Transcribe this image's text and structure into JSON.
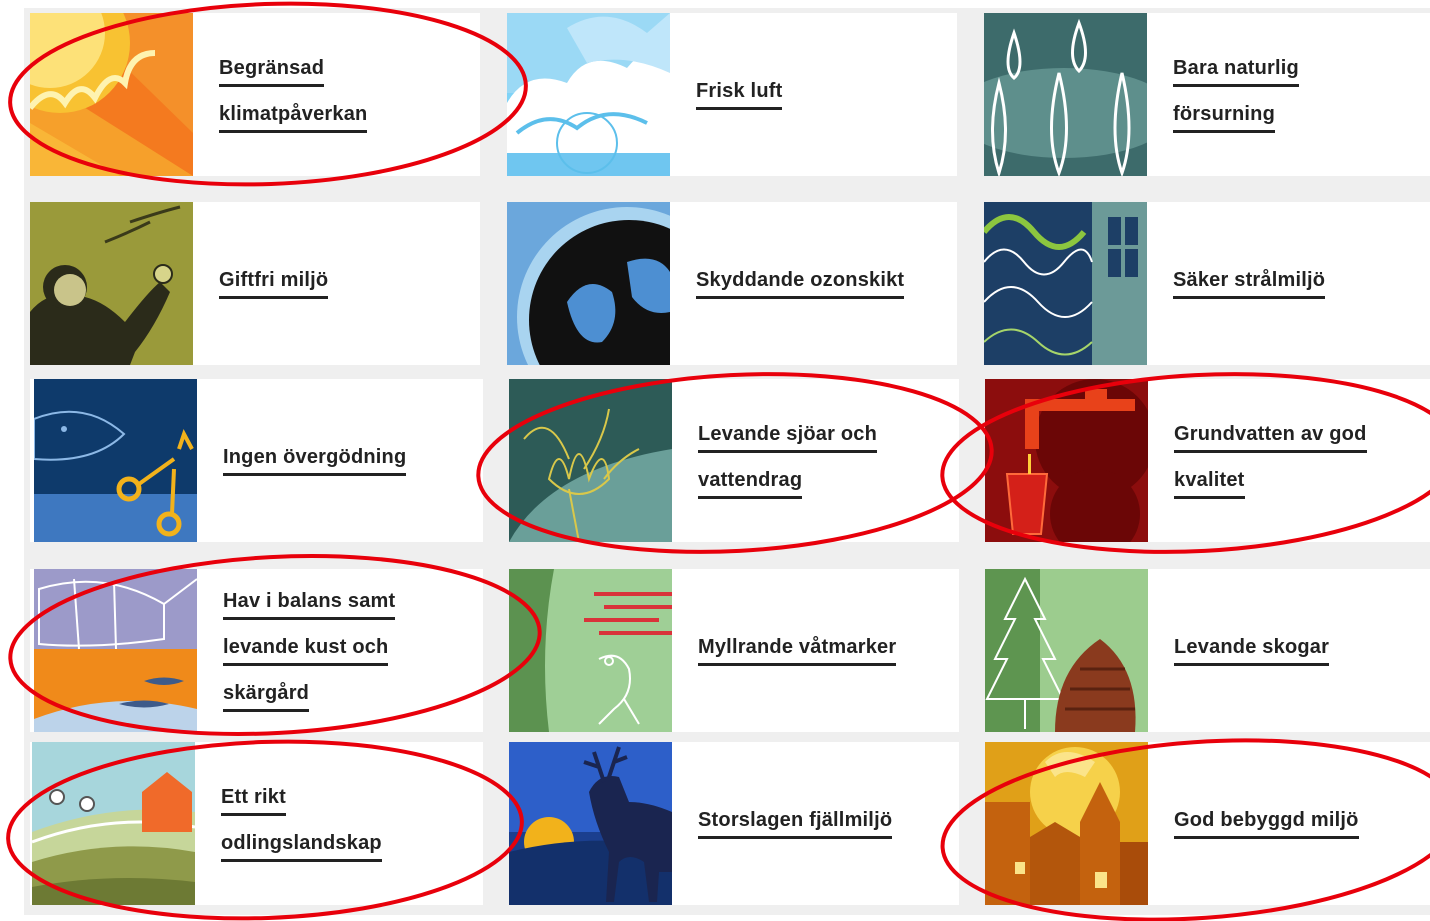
{
  "tiles": [
    {
      "id": "klimat",
      "lines": [
        "Begränsad",
        "klimatpåverkan"
      ],
      "icon": "sun-rays-icon"
    },
    {
      "id": "luft",
      "lines": [
        "Frisk luft"
      ],
      "icon": "clouds-icon"
    },
    {
      "id": "forsurning",
      "lines": [
        "Bara naturlig",
        "försurning"
      ],
      "icon": "raindrops-icon"
    },
    {
      "id": "giftfri",
      "lines": [
        "Giftfri miljö"
      ],
      "icon": "person-apple-icon"
    },
    {
      "id": "ozon",
      "lines": [
        "Skyddande ozonskikt"
      ],
      "icon": "globe-icon"
    },
    {
      "id": "stral",
      "lines": [
        "Säker strålmiljö"
      ],
      "icon": "waves-window-icon"
    },
    {
      "id": "overgodning",
      "lines": [
        "Ingen övergödning"
      ],
      "icon": "fish-molecule-icon"
    },
    {
      "id": "sjoar",
      "lines": [
        "Levande sjöar och",
        "vattendrag"
      ],
      "icon": "water-lily-icon"
    },
    {
      "id": "grundvatten",
      "lines": [
        "Grundvatten av god",
        "kvalitet"
      ],
      "icon": "tap-glass-icon"
    },
    {
      "id": "hav",
      "lines": [
        "Hav i balans samt",
        "levande kust och",
        "skärgård"
      ],
      "icon": "boat-fish-icon"
    },
    {
      "id": "vatmarker",
      "lines": [
        "Myllrande våtmarker"
      ],
      "icon": "frog-icon"
    },
    {
      "id": "skogar",
      "lines": [
        "Levande skogar"
      ],
      "icon": "tree-cone-icon"
    },
    {
      "id": "odling",
      "lines": [
        "Ett rikt",
        "odlingslandskap"
      ],
      "icon": "farm-fields-icon"
    },
    {
      "id": "fjall",
      "lines": [
        "Storslagen fjällmiljö"
      ],
      "icon": "reindeer-icon"
    },
    {
      "id": "bebyggd",
      "lines": [
        "God bebyggd miljö"
      ],
      "icon": "town-sun-icon"
    }
  ],
  "annotation_color": "#e8000b"
}
